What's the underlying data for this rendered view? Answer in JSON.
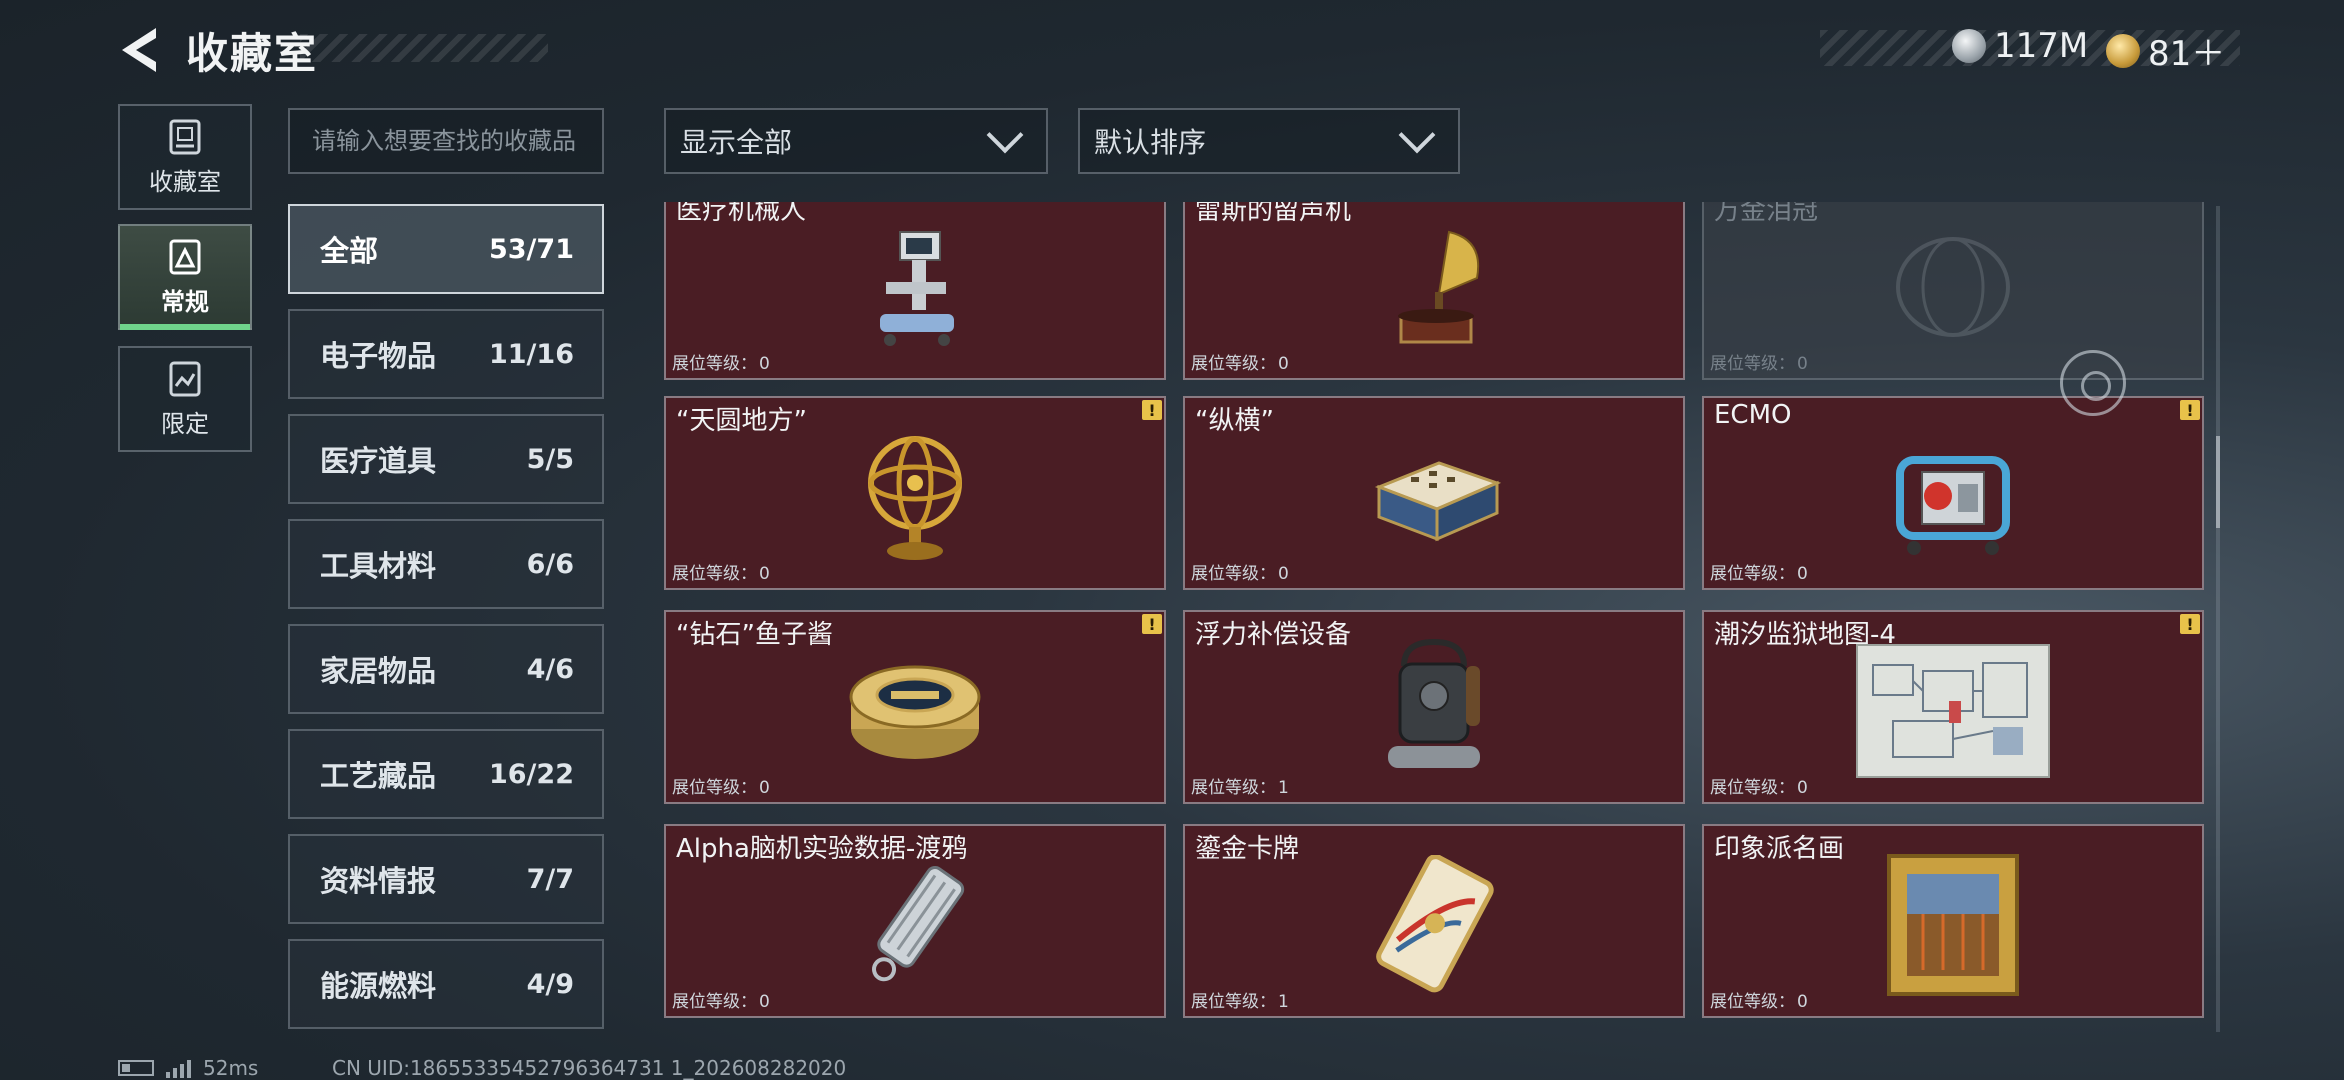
{
  "header": {
    "title": "收藏室"
  },
  "currency": [
    {
      "value": "117M",
      "icon": "silver-coin-icon"
    },
    {
      "value": "81＋",
      "icon": "gold-coin-icon"
    }
  ],
  "nav": [
    {
      "label": "收藏室",
      "icon": "collection-room-icon"
    },
    {
      "label": "常规",
      "icon": "regular-icon",
      "active": true
    },
    {
      "label": "限定",
      "icon": "limited-icon"
    }
  ],
  "search": {
    "placeholder": "请输入想要查找的收藏品"
  },
  "filters": {
    "show_all": "显示全部",
    "sort": "默认排序"
  },
  "categories": [
    {
      "name": "全部",
      "count": "53/71",
      "active": true
    },
    {
      "name": "电子物品",
      "count": "11/16"
    },
    {
      "name": "医疗道具",
      "count": "5/5"
    },
    {
      "name": "工具材料",
      "count": "6/6"
    },
    {
      "name": "家居物品",
      "count": "4/6"
    },
    {
      "name": "工艺藏品",
      "count": "16/22"
    },
    {
      "name": "资料情报",
      "count": "7/7"
    },
    {
      "name": "能源燃料",
      "count": "4/9"
    }
  ],
  "level_label": "展位等级：",
  "items": [
    {
      "name": "医疗机械人",
      "level": "0",
      "icon": "medical-robot-icon"
    },
    {
      "name": "雷斯的留声机",
      "level": "0",
      "icon": "gramophone-icon"
    },
    {
      "name": "万金泪冠",
      "level": "0",
      "icon": "crown-icon",
      "dim": true
    },
    {
      "name": "“天圆地方”",
      "level": "0",
      "icon": "armillary-sphere-icon",
      "warn": true
    },
    {
      "name": "“纵横”",
      "level": "0",
      "icon": "chess-box-icon"
    },
    {
      "name": "ECMO",
      "level": "0",
      "icon": "ecmo-machine-icon",
      "warn": true
    },
    {
      "name": "“钻石”鱼子酱",
      "level": "0",
      "icon": "caviar-tin-icon",
      "warn": true
    },
    {
      "name": "浮力补偿设备",
      "level": "1",
      "icon": "buoyancy-device-icon"
    },
    {
      "name": "潮汐监狱地图-4",
      "level": "0",
      "icon": "map-icon",
      "warn": true
    },
    {
      "name": "Alpha脑机实验数据-渡鸦",
      "level": "0",
      "icon": "data-cylinder-icon"
    },
    {
      "name": "鎏金卡牌",
      "level": "1",
      "icon": "gilded-card-icon"
    },
    {
      "name": "印象派名画",
      "level": "0",
      "icon": "framed-painting-icon"
    }
  ],
  "footer": {
    "ping": "52ms",
    "uid": "CN UID:18655335452796364731 1_202608282020"
  },
  "colors": {
    "card_bg": "#4a1d24",
    "accent_green": "#6fd48b",
    "warn_yellow": "#e8c24a"
  }
}
